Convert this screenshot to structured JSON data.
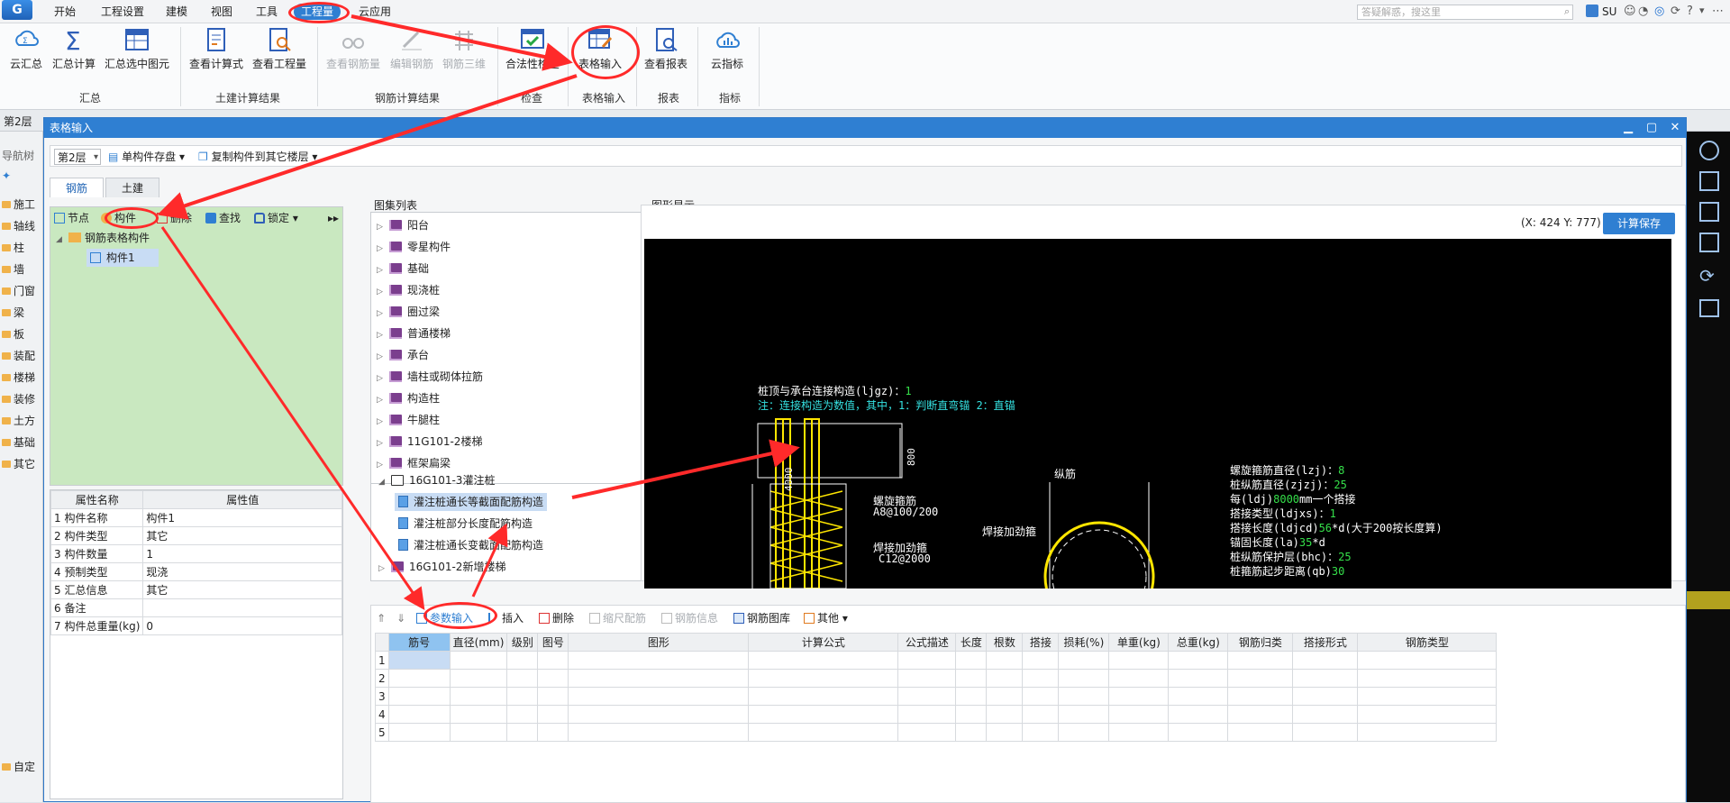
{
  "menu": {
    "app_icon": "G",
    "items": [
      "开始",
      "工程设置",
      "建模",
      "视图",
      "工具",
      "工程量",
      "云应用"
    ],
    "active": "工程量",
    "search_placeholder": "答疑解惑，搜这里",
    "user": "SU"
  },
  "ribbon": {
    "groups": [
      {
        "label": "汇总",
        "buttons": [
          "云汇总",
          "汇总计算",
          "汇总选中图元"
        ]
      },
      {
        "label": "土建计算结果",
        "buttons": [
          "查看计算式",
          "查看工程量"
        ]
      },
      {
        "label": "钢筋计算结果",
        "buttons": [
          "查看钢筋量",
          "编辑钢筋",
          "钢筋三维"
        ]
      },
      {
        "label": "检查",
        "buttons": [
          "合法性检查"
        ]
      },
      {
        "label": "表格输入",
        "buttons": [
          "表格输入"
        ]
      },
      {
        "label": "报表",
        "buttons": [
          "查看报表"
        ]
      },
      {
        "label": "指标",
        "buttons": [
          "云指标"
        ]
      }
    ]
  },
  "floor_strip": {
    "floor": "第2层"
  },
  "left_nav": {
    "title": "导航树",
    "items": [
      "施工",
      "轴线",
      "柱",
      "墙",
      "门窗",
      "梁",
      "板",
      "装配",
      "楼梯",
      "装修",
      "土方",
      "基础",
      "其它",
      "自定"
    ]
  },
  "dialog": {
    "title": "表格输入",
    "toolbar": {
      "floor": "第2层",
      "save_single": "单构件存盘",
      "copy_to_floor": "复制构件到其它楼层"
    },
    "tabs": [
      "钢筋",
      "土建"
    ],
    "active_tab": "钢筋",
    "left_toolbar": [
      "节点",
      "构件",
      "删除",
      "查找",
      "锁定"
    ],
    "tree": {
      "root": "钢筋表格构件",
      "child": "构件1"
    },
    "props": {
      "headers": [
        "属性名称",
        "属性值"
      ],
      "rows": [
        [
          "1",
          "构件名称",
          "构件1"
        ],
        [
          "2",
          "构件类型",
          "其它"
        ],
        [
          "3",
          "构件数量",
          "1"
        ],
        [
          "4",
          "预制类型",
          "现浇"
        ],
        [
          "5",
          "汇总信息",
          "其它"
        ],
        [
          "6",
          "备注",
          ""
        ],
        [
          "7",
          "构件总重量(kg)",
          "0"
        ]
      ]
    },
    "atlas": {
      "title": "图集列表",
      "items": [
        "阳台",
        "零星构件",
        "基础",
        "现浇桩",
        "圈过梁",
        "普通楼梯",
        "承台",
        "墙柱或砌体拉筋",
        "构造柱",
        "牛腿柱",
        "11G101-2楼梯",
        "框架扁梁",
        "16G101-3灌注桩"
      ],
      "children": [
        "灌注桩通长等截面配筋构造",
        "灌注桩部分长度配筋构造",
        "灌注桩通长变截面配筋构造"
      ],
      "last": "16G101-2新增楼梯"
    },
    "graphic": {
      "title": "图形显示",
      "coord": "(X: 424 Y: 777)",
      "calc_save": "计算保存",
      "top_label": "桩顶与承台连接构造(ljgz)：",
      "top_label_val": "1",
      "note": "注：连接构造为数值，其中，1：判断直弯锚     2：直锚",
      "spiral": "螺旋箍筋",
      "spiral_spec": "A8@100/200",
      "weld": "焊接加劲箍",
      "weld_spec": "C12@2000",
      "weld2": "焊接加劲箍",
      "long_bar": "纵筋",
      "dim1": "4000",
      "dim2": "800",
      "params": [
        [
          "螺旋箍筋直径(lzj)：",
          "8",
          ""
        ],
        [
          "桩纵筋直径(zjzj)：",
          "25",
          ""
        ],
        [
          "每(ldj)",
          "8000",
          "mm一个搭接"
        ],
        [
          "搭接类型(ldjxs)：",
          "1",
          ""
        ],
        [
          "搭接长度(ldjcd)",
          "56",
          "*d(大于200按长度算)"
        ],
        [
          "锚固长度(la)",
          "35",
          "*d"
        ],
        [
          "桩纵筋保护层(bhc)：",
          "25",
          ""
        ],
        [
          "桩箍筋起步距离(qb)",
          "30",
          ""
        ]
      ]
    },
    "rebar_toolbar": [
      "参数输入",
      "插入",
      "删除",
      "缩尺配筋",
      "钢筋信息",
      "钢筋图库",
      "其他"
    ],
    "rebar_headers": [
      "筋号",
      "直径(mm)",
      "级别",
      "图号",
      "图形",
      "计算公式",
      "公式描述",
      "长度",
      "根数",
      "搭接",
      "损耗(%)",
      "单重(kg)",
      "总重(kg)",
      "钢筋归类",
      "搭接形式",
      "钢筋类型"
    ],
    "rebar_rows": [
      "1",
      "2",
      "3",
      "4",
      "5"
    ]
  },
  "accent": "#2f7fd2",
  "highlight": "#ff2a2a"
}
